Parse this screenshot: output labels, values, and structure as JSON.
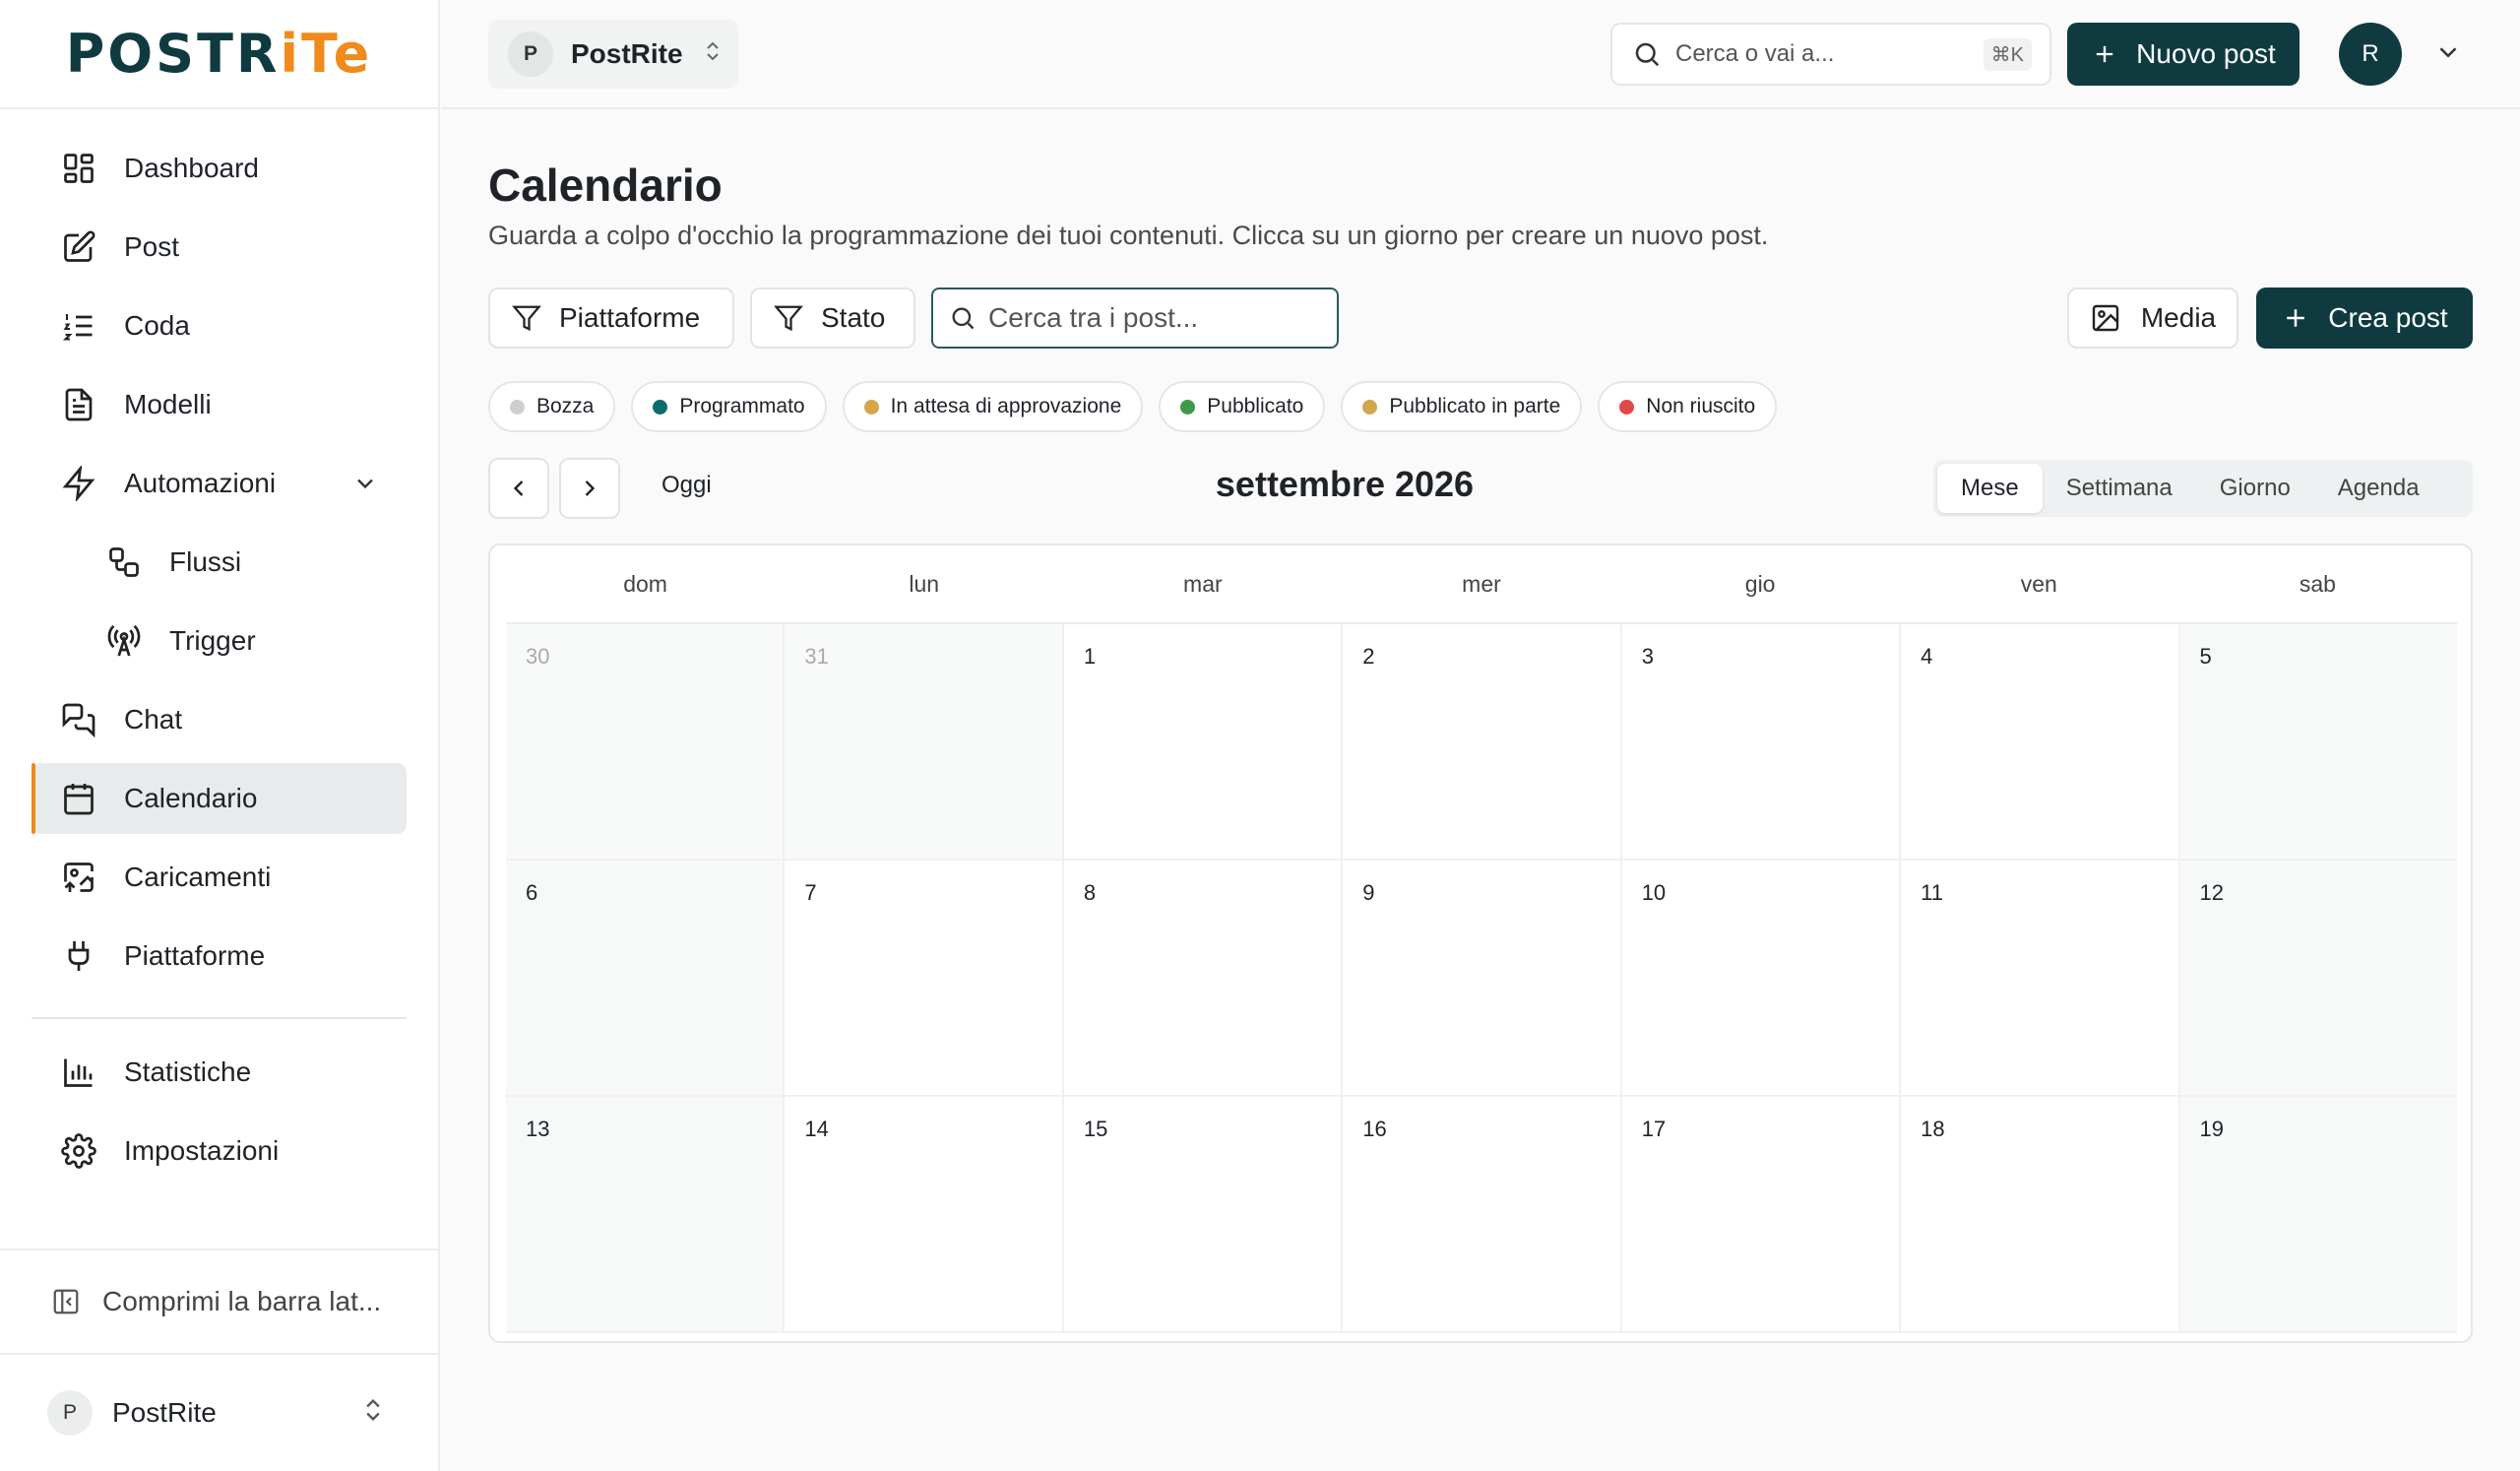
{
  "brand": {
    "logo_main": "POSTR",
    "logo_accent": "iTe"
  },
  "sidebar": {
    "items": [
      {
        "label": "Dashboard"
      },
      {
        "label": "Post"
      },
      {
        "label": "Coda"
      },
      {
        "label": "Modelli"
      },
      {
        "label": "Automazioni"
      },
      {
        "label": "Flussi"
      },
      {
        "label": "Trigger"
      },
      {
        "label": "Chat"
      },
      {
        "label": "Calendario"
      },
      {
        "label": "Caricamenti"
      },
      {
        "label": "Piattaforme"
      },
      {
        "label": "Statistiche"
      },
      {
        "label": "Impostazioni"
      }
    ],
    "collapse_label": "Comprimi la barra lat...",
    "workspace": {
      "initial": "P",
      "name": "PostRite"
    }
  },
  "topbar": {
    "workspace": {
      "initial": "P",
      "name": "PostRite"
    },
    "search_placeholder": "Cerca o vai a...",
    "shortcut": "⌘K",
    "new_post": "Nuovo post",
    "user_initial": "R"
  },
  "page": {
    "title": "Calendario",
    "subtitle": "Guarda a colpo d'occhio la programmazione dei tuoi contenuti. Clicca su un giorno per creare un nuovo post.",
    "filter_platforms": "Piattaforme",
    "filter_status": "Stato",
    "search_placeholder": "Cerca tra i post...",
    "media": "Media",
    "create_post": "Crea post"
  },
  "legend": [
    {
      "label": "Bozza",
      "color": "#cfcfcf"
    },
    {
      "label": "Programmato",
      "color": "#0f6b70"
    },
    {
      "label": "In attesa di approvazione",
      "color": "#d4a64a"
    },
    {
      "label": "Pubblicato",
      "color": "#3e9a4a"
    },
    {
      "label": "Pubblicato in parte",
      "color": "#d4a64a"
    },
    {
      "label": "Non riuscito",
      "color": "#e04848"
    }
  ],
  "calendar": {
    "today_label": "Oggi",
    "month_label": "settembre 2026",
    "views": [
      "Mese",
      "Settimana",
      "Giorno",
      "Agenda"
    ],
    "active_view": "Mese",
    "weekdays": [
      "dom",
      "lun",
      "mar",
      "mer",
      "gio",
      "ven",
      "sab"
    ],
    "weeks": [
      [
        "30",
        "31",
        "1",
        "2",
        "3",
        "4",
        "5"
      ],
      [
        "6",
        "7",
        "8",
        "9",
        "10",
        "11",
        "12"
      ],
      [
        "13",
        "14",
        "15",
        "16",
        "17",
        "18",
        "19"
      ]
    ]
  }
}
